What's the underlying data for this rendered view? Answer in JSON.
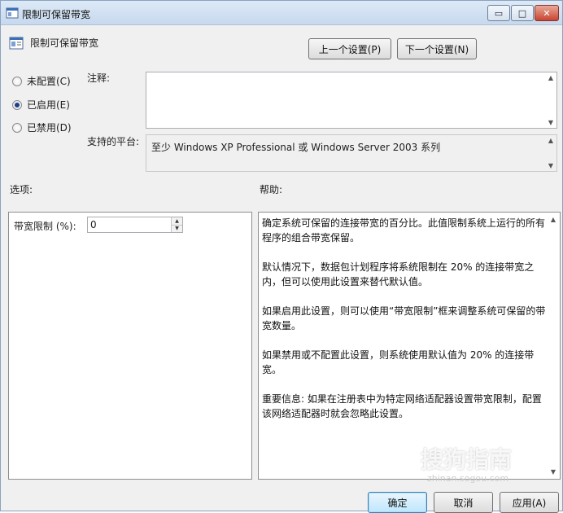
{
  "window": {
    "title": "限制可保留带宽",
    "controls": {
      "minimize": "▭",
      "maximize": "□",
      "close": "✕"
    }
  },
  "header": {
    "title": "限制可保留带宽",
    "prev_button": "上一个设置(P)",
    "next_button": "下一个设置(N)"
  },
  "state": {
    "options": [
      {
        "label": "未配置(C)",
        "checked": false
      },
      {
        "label": "已启用(E)",
        "checked": true
      },
      {
        "label": "已禁用(D)",
        "checked": false
      }
    ]
  },
  "comment": {
    "label": "注释:",
    "value": ""
  },
  "platform": {
    "label": "支持的平台:",
    "value": "至少 Windows XP Professional 或 Windows Server 2003 系列"
  },
  "options_section": {
    "label": "选项:",
    "bandwidth_label": "带宽限制 (%):",
    "bandwidth_value": "0"
  },
  "help_section": {
    "label": "帮助:",
    "paragraphs": [
      "确定系统可保留的连接带宽的百分比。此值限制系统上运行的所有程序的组合带宽保留。",
      "默认情况下，数据包计划程序将系统限制在 20% 的连接带宽之内，但可以使用此设置来替代默认值。",
      "如果启用此设置，则可以使用“带宽限制”框来调整系统可保留的带宽数量。",
      "如果禁用或不配置此设置，则系统使用默认值为 20% 的连接带宽。",
      "重要信息: 如果在注册表中为特定网络适配器设置带宽限制，配置该网络适配器时就会忽略此设置。"
    ]
  },
  "footer": {
    "ok": "确定",
    "cancel": "取消",
    "apply": "应用(A)"
  },
  "watermark": {
    "text": "搜狗指南",
    "url": "zhinan.sogou.com"
  }
}
